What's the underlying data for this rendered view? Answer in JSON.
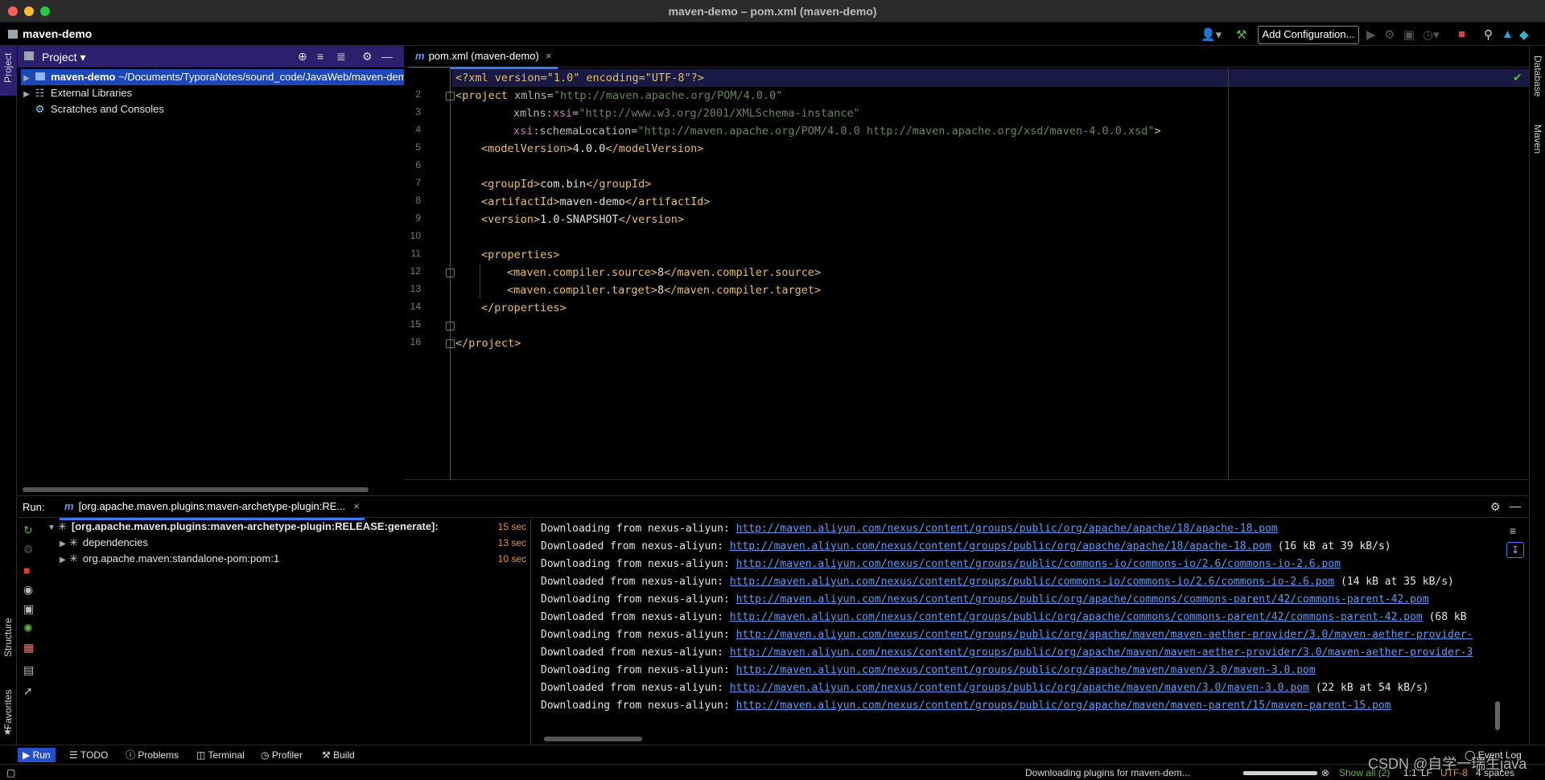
{
  "window": {
    "title": "maven-demo – pom.xml (maven-demo)"
  },
  "navbar": {
    "project_name": "maven-demo",
    "add_configuration": "Add Configuration..."
  },
  "left_strip": {
    "project": "Project",
    "structure": "Structure",
    "favorites": "Favorites"
  },
  "right_strip": {
    "database": "Database",
    "maven": "Maven"
  },
  "project_panel": {
    "title": "Project",
    "tree": {
      "root_name": "maven-demo",
      "root_path": "~/Documents/TyporaNotes/sound_code/JavaWeb/maven-demo",
      "external_libraries": "External Libraries",
      "scratches": "Scratches and Consoles"
    }
  },
  "editor": {
    "tab_label": "pom.xml (maven-demo)",
    "line_numbers": [
      "2",
      "3",
      "4",
      "5",
      "6",
      "7",
      "8",
      "9",
      "10",
      "11",
      "12",
      "13",
      "14",
      "15",
      "16"
    ],
    "code": {
      "l1": "<?xml version=\"1.0\" encoding=\"UTF-8\"?>",
      "l2_tag": "<project ",
      "l2_attr": "xmlns=",
      "l2_val": "\"http://maven.apache.org/POM/4.0.0\"",
      "l3_attr": "xmlns:",
      "l3_ns": "xsi",
      "l3_eq": "=",
      "l3_val": "\"http://www.w3.org/2001/XMLSchema-instance\"",
      "l4_ns": "xsi",
      "l4_attr": ":schemaLocation=",
      "l4_val": "\"http://maven.apache.org/POM/4.0.0 http://maven.apache.org/xsd/maven-4.0.0.xsd\"",
      "l4_end": ">",
      "l5_open": "<modelVersion>",
      "l5_text": "4.0.0",
      "l5_close": "</modelVersion>",
      "l7_open": "<groupId>",
      "l7_text": "com.bin",
      "l7_close": "</groupId>",
      "l8_open": "<artifactId>",
      "l8_text": "maven-demo",
      "l8_close": "</artifactId>",
      "l9_open": "<version>",
      "l9_text": "1.0-SNAPSHOT",
      "l9_close": "</version>",
      "l11": "<properties>",
      "l12_open": "<maven.compiler.source>",
      "l12_text": "8",
      "l12_close": "</maven.compiler.source>",
      "l13_open": "<maven.compiler.target>",
      "l13_text": "8",
      "l13_close": "</maven.compiler.target>",
      "l14": "</properties>",
      "l16": "</project>"
    }
  },
  "run_panel": {
    "label": "Run:",
    "tab_label": "[org.apache.maven.plugins:maven-archetype-plugin:RE...",
    "tree": [
      {
        "text": "[org.apache.maven.plugins:maven-archetype-plugin:RELEASE:generate]:",
        "time": "15 sec"
      },
      {
        "text": "dependencies",
        "time": "13 sec"
      },
      {
        "text": "org.apache.maven:standalone-pom:pom:1",
        "time": "10 sec"
      }
    ],
    "console": [
      {
        "prefix": "Downloading from nexus-aliyun: ",
        "url": "http://maven.aliyun.com/nexus/content/groups/public/org/apache/apache/18/apache-18.pom",
        "suffix": ""
      },
      {
        "prefix": "Downloaded from nexus-aliyun: ",
        "url": "http://maven.aliyun.com/nexus/content/groups/public/org/apache/apache/18/apache-18.pom",
        "suffix": " (16 kB at 39 kB/s)"
      },
      {
        "prefix": "Downloading from nexus-aliyun: ",
        "url": "http://maven.aliyun.com/nexus/content/groups/public/commons-io/commons-io/2.6/commons-io-2.6.pom",
        "suffix": ""
      },
      {
        "prefix": "Downloaded from nexus-aliyun: ",
        "url": "http://maven.aliyun.com/nexus/content/groups/public/commons-io/commons-io/2.6/commons-io-2.6.pom",
        "suffix": " (14 kB at 35 kB/s)"
      },
      {
        "prefix": "Downloading from nexus-aliyun: ",
        "url": "http://maven.aliyun.com/nexus/content/groups/public/org/apache/commons/commons-parent/42/commons-parent-42.pom",
        "suffix": ""
      },
      {
        "prefix": "Downloaded from nexus-aliyun: ",
        "url": "http://maven.aliyun.com/nexus/content/groups/public/org/apache/commons/commons-parent/42/commons-parent-42.pom",
        "suffix": " (68 kB"
      },
      {
        "prefix": "Downloading from nexus-aliyun: ",
        "url": "http://maven.aliyun.com/nexus/content/groups/public/org/apache/maven/maven-aether-provider/3.0/maven-aether-provider-",
        "suffix": ""
      },
      {
        "prefix": "Downloaded from nexus-aliyun: ",
        "url": "http://maven.aliyun.com/nexus/content/groups/public/org/apache/maven/maven-aether-provider/3.0/maven-aether-provider-3",
        "suffix": ""
      },
      {
        "prefix": "Downloading from nexus-aliyun: ",
        "url": "http://maven.aliyun.com/nexus/content/groups/public/org/apache/maven/maven/3.0/maven-3.0.pom",
        "suffix": ""
      },
      {
        "prefix": "Downloaded from nexus-aliyun: ",
        "url": "http://maven.aliyun.com/nexus/content/groups/public/org/apache/maven/maven/3.0/maven-3.0.pom",
        "suffix": " (22 kB at 54 kB/s)"
      },
      {
        "prefix": "Downloading from nexus-aliyun: ",
        "url": "http://maven.aliyun.com/nexus/content/groups/public/org/apache/maven/maven-parent/15/maven-parent-15.pom",
        "suffix": ""
      }
    ]
  },
  "bottom_bar": {
    "run": "Run",
    "todo": "TODO",
    "problems": "Problems",
    "terminal": "Terminal",
    "profiler": "Profiler",
    "build": "Build",
    "event_log": "Event Log"
  },
  "status_bar": {
    "message": "Downloading plugins for maven-dem...",
    "show_all": "Show all (2)",
    "position": "1:1",
    "line_sep": "LF",
    "encoding": "UTF-8",
    "indent": "4 spaces"
  },
  "watermark": "CSDN @自学一瑞生java",
  "colors": {
    "accent": "#3d79f0",
    "tag": "#e8bf6a",
    "string": "#6a8759",
    "namespace": "#c77dbb",
    "link": "#5f9bf0",
    "time": "#e09a3a"
  }
}
